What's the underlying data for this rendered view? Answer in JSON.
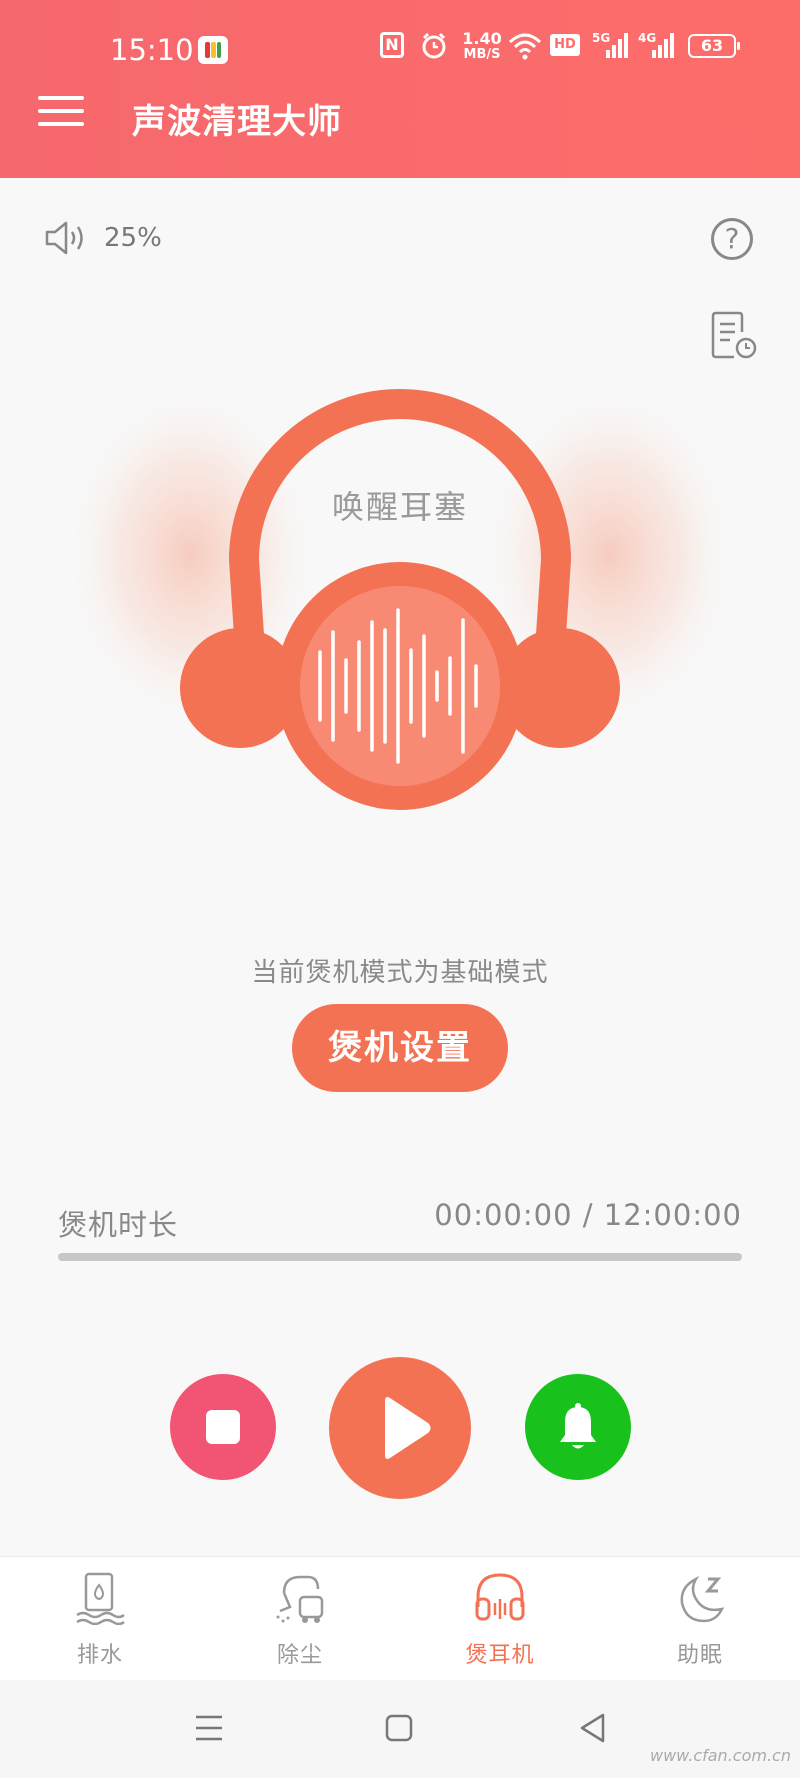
{
  "status_bar": {
    "time": "15:10",
    "net_speed_value": "1.40",
    "net_speed_unit": "MB/S",
    "nfc_label": "N",
    "hd_label": "HD",
    "sim1_label": "5G",
    "sim2_label": "4G",
    "battery": "63"
  },
  "header": {
    "title": "声波清理大师"
  },
  "volume": {
    "level": "25%"
  },
  "help": {
    "label": "?"
  },
  "player": {
    "title": "唤醒耳塞",
    "mode_text": "当前煲机模式为基础模式",
    "settings_button": "煲机设置"
  },
  "duration": {
    "label": "煲机时长",
    "time": "00:00:00 / 12:00:00",
    "progress": 0
  },
  "controls": {
    "stop": "stop-icon",
    "play": "play-icon",
    "alarm": "bell-icon"
  },
  "bottom_nav": {
    "items": [
      {
        "label": "排水",
        "icon": "drain-icon"
      },
      {
        "label": "除尘",
        "icon": "vacuum-icon"
      },
      {
        "label": "煲耳机",
        "icon": "headphone-icon",
        "active": true
      },
      {
        "label": "助眠",
        "icon": "moon-icon"
      }
    ]
  },
  "colors": {
    "header": "#f96b6c",
    "accent": "#f47254",
    "stop": "#f25573",
    "alarm": "#19c11d"
  },
  "watermark": "www.cfan.com.cn"
}
